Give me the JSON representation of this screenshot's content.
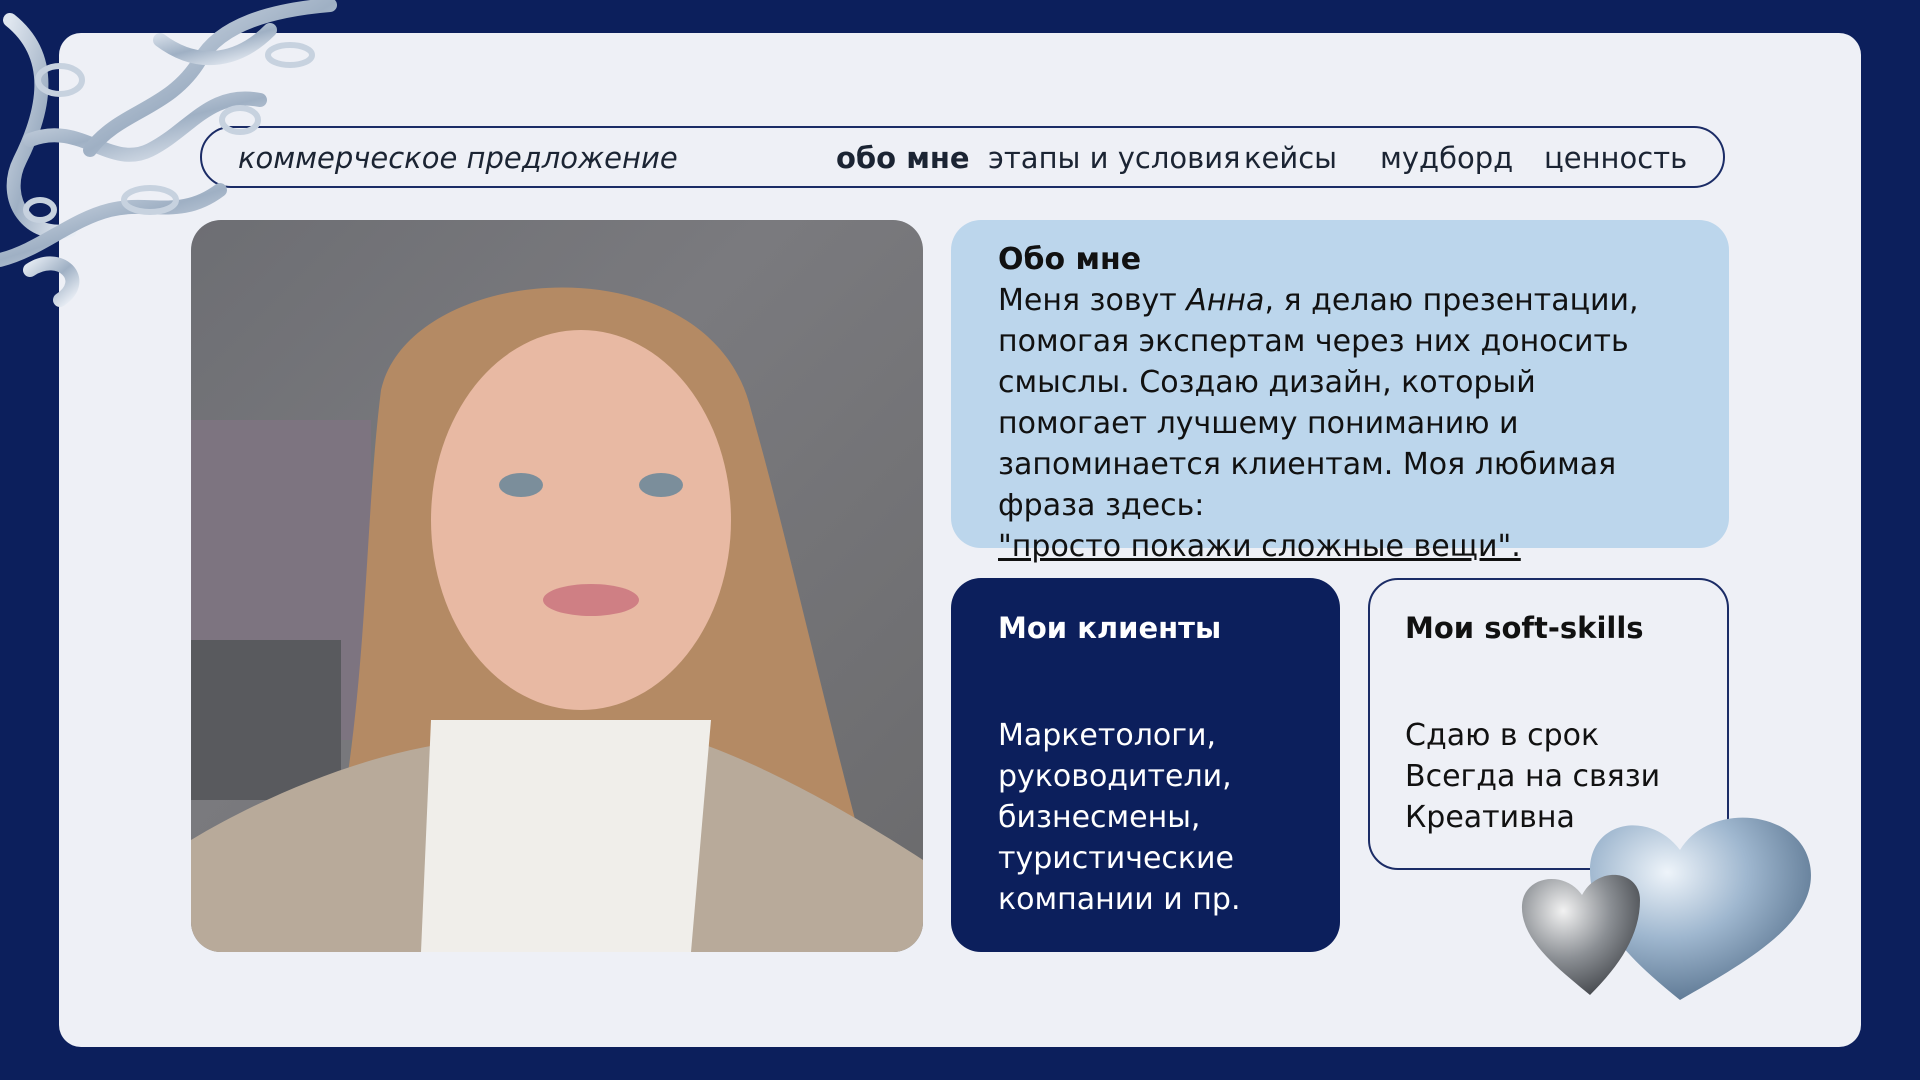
{
  "nav": {
    "brand": "коммерческое предложение",
    "links": [
      {
        "label": "обо мне",
        "active": true
      },
      {
        "label": "этапы и условия",
        "active": false
      },
      {
        "label": "кейсы",
        "active": false
      },
      {
        "label": "мудборд",
        "active": false
      },
      {
        "label": "ценность",
        "active": false
      }
    ]
  },
  "about": {
    "heading": "Обо мне",
    "text_before_name": "Меня зовут ",
    "name": "Анна",
    "text_after_name": ", я делаю презентации, помогая экспертам через них доносить смыслы. Создаю дизайн, который помогает лучшему пониманию и запоминается клиентам. Моя любимая фраза здесь:",
    "quote": "\"просто покажи сложные вещи\". "
  },
  "clients": {
    "heading": "Мои клиенты",
    "lines": [
      "Маркетологи,",
      "руководители,",
      "бизнесмены,",
      "туристические",
      "компании и пр."
    ]
  },
  "skills": {
    "heading": "Мои soft-skills",
    "items": [
      "Сдаю в срок",
      "Всегда на связи",
      "Креативна"
    ]
  },
  "colors": {
    "background": "#0c1f5c",
    "panel": "#eef0f6",
    "about_card": "#bcd6ec",
    "clients_card": "#0c1f5c"
  },
  "icons": [
    "chrome-ornament",
    "chrome-hearts"
  ]
}
